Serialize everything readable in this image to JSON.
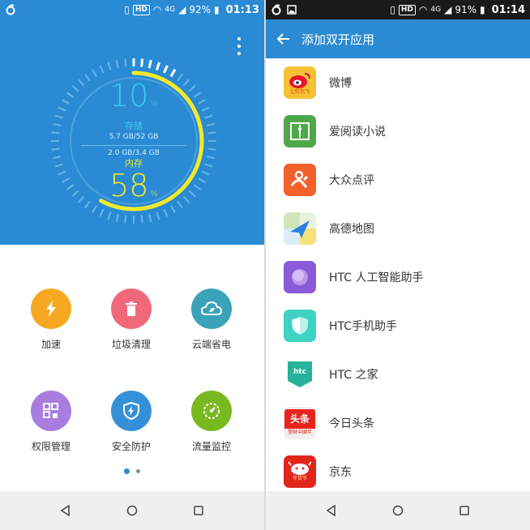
{
  "left": {
    "status": {
      "battery": "92%",
      "time": "01:13",
      "hd": "HD",
      "network": "4G"
    },
    "storage": {
      "percent": "10",
      "pct_sign": "%",
      "label": "存储",
      "detail": "5.7 GB/52 GB"
    },
    "memory": {
      "percent": "58",
      "pct_sign": "%",
      "label": "内存",
      "detail": "2.0 GB/3.4 GB"
    },
    "tools": [
      {
        "label": "加速",
        "icon": "lightning-icon",
        "color": "#f7a823"
      },
      {
        "label": "垃圾清理",
        "icon": "trash-icon",
        "color": "#f1687b"
      },
      {
        "label": "云端省电",
        "icon": "cloud-leaf-icon",
        "color": "#3aa3b9"
      },
      {
        "label": "权限管理",
        "icon": "permission-grid-icon",
        "color": "#a77de0"
      },
      {
        "label": "安全防护",
        "icon": "shield-icon",
        "color": "#3590d8"
      },
      {
        "label": "流量监控",
        "icon": "speedometer-icon",
        "color": "#7ab81f"
      }
    ],
    "page_indicator": {
      "current": 1,
      "total": 2
    }
  },
  "right": {
    "status": {
      "battery": "91%",
      "time": "01:14",
      "hd": "HD",
      "network": "4G"
    },
    "title": "添加双开应用",
    "apps": [
      {
        "name": "微博",
        "icon": "weibo-icon"
      },
      {
        "name": "爱阅读小说",
        "icon": "book-icon"
      },
      {
        "name": "大众点评",
        "icon": "dianping-icon"
      },
      {
        "name": "高德地图",
        "icon": "amap-icon"
      },
      {
        "name": "HTC 人工智能助手",
        "icon": "htc-ai-icon"
      },
      {
        "name": "HTC手机助手",
        "icon": "htc-shield-icon"
      },
      {
        "name": "HTC 之家",
        "icon": "htc-home-icon"
      },
      {
        "name": "今日头条",
        "icon": "toutiao-icon"
      },
      {
        "name": "京东",
        "icon": "jd-icon"
      }
    ],
    "icon_text": {
      "weibo": "让红包飞",
      "toutiao_main": "头条",
      "toutiao_sub": "發財中國年",
      "htc": "htc",
      "jd": "年货节"
    }
  },
  "colors": {
    "accent": "#2a8bd4",
    "storage": "#3fc8ef",
    "memory": "#f2e92a"
  }
}
